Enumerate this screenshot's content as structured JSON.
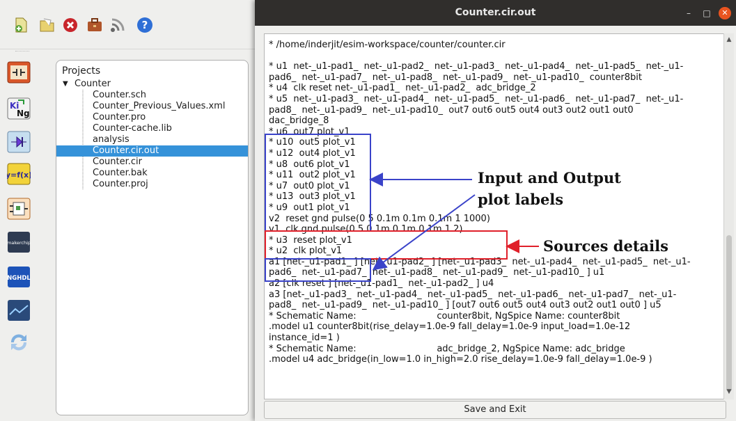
{
  "esim": {
    "toolbar_icons": [
      "new-project-icon",
      "open-project-icon",
      "close-project-icon",
      "briefcase-icon",
      "wifi-icon",
      "help-icon"
    ],
    "side_tools": [
      "schematic-editor-icon",
      "kicad-to-ngspice-icon",
      "footprint-editor-icon",
      "model-editor-icon",
      "subcircuit-icon",
      "makerchip-icon",
      "nghdl-icon",
      "omedit-icon",
      "refresh-icon"
    ],
    "makerchip_label": "makerchip",
    "nghdl_label": "NGHDL",
    "projects": {
      "header": "Projects",
      "root": "Counter",
      "files": [
        "Counter.sch",
        "Counter_Previous_Values.xml",
        "Counter.pro",
        "Counter-cache.lib",
        "analysis",
        "Counter.cir.out",
        "Counter.cir",
        "Counter.bak",
        "Counter.proj"
      ],
      "selected": "Counter.cir.out"
    }
  },
  "dialog": {
    "title": "Counter.cir.out",
    "minimize": "–",
    "maximize": "□",
    "close": "✕",
    "lines": [
      "* /home/inderjit/esim-workspace/counter/counter.cir",
      "",
      "* u1  net-_u1-pad1_  net-_u1-pad2_  net-_u1-pad3_  net-_u1-pad4_  net-_u1-pad5_  net-_u1-",
      "pad6_  net-_u1-pad7_  net-_u1-pad8_  net-_u1-pad9_  net-_u1-pad10_  counter8bit",
      "* u4  clk reset net-_u1-pad1_  net-_u1-pad2_  adc_bridge_2",
      "* u5  net-_u1-pad3_  net-_u1-pad4_  net-_u1-pad5_  net-_u1-pad6_  net-_u1-pad7_  net-_u1-",
      "pad8_  net-_u1-pad9_  net-_u1-pad10_  out7 out6 out5 out4 out3 out2 out1 out0",
      "dac_bridge_8",
      "* u6  out7 plot_v1",
      "* u10  out5 plot_v1",
      "* u12  out4 plot_v1",
      "* u8  out6 plot_v1",
      "* u11  out2 plot_v1",
      "* u7  out0 plot_v1",
      "* u13  out3 plot_v1",
      "* u9  out1 plot_v1",
      "v2  reset gnd pulse(0 5 0.1m 0.1m 0.1m 1 1000)",
      "v1  clk gnd pulse(0 5 0.1m 0.1m 0.1m 1 2)",
      "* u3  reset plot_v1",
      "* u2  clk plot_v1",
      "a1 [net-_u1-pad1_ ] [net-_u1-pad2_ ] [net-_u1-pad3_  net-_u1-pad4_  net-_u1-pad5_  net-_u1-",
      "pad6_  net-_u1-pad7_  net-_u1-pad8_  net-_u1-pad9_  net-_u1-pad10_ ] u1",
      "a2 [clk reset ] [net-_u1-pad1_  net-_u1-pad2_ ] u4",
      "a3 [net-_u1-pad3_  net-_u1-pad4_  net-_u1-pad5_  net-_u1-pad6_  net-_u1-pad7_  net-_u1-",
      "pad8_  net-_u1-pad9_  net-_u1-pad10_ ] [out7 out6 out5 out4 out3 out2 out1 out0 ] u5",
      "* Schematic Name:                            counter8bit, NgSpice Name: counter8bit",
      ".model u1 counter8bit(rise_delay=1.0e-9 fall_delay=1.0e-9 input_load=1.0e-12",
      "instance_id=1 )",
      "* Schematic Name:                            adc_bridge_2, NgSpice Name: adc_bridge",
      ".model u4 adc_bridge(in_low=1.0 in_high=2.0 rise_delay=1.0e-9 fall_delay=1.0e-9 )"
    ],
    "save_label": "Save and Exit"
  },
  "annotations": {
    "plot_labels": "Input and Output\nplot labels",
    "plot_labels_line1": "Input and Output",
    "plot_labels_line2": "plot labels",
    "sources": "Sources details",
    "colors": {
      "blue": "#3a43c9",
      "red": "#e0202a"
    }
  }
}
